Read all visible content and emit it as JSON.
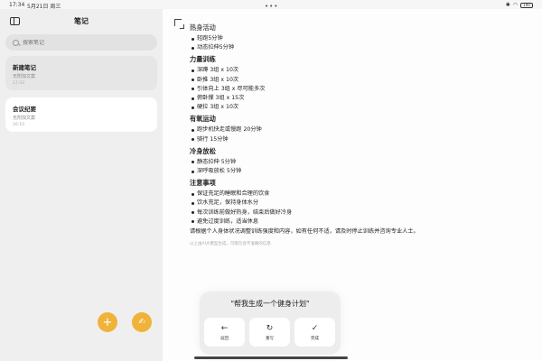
{
  "statusbar": {
    "time": "17:34",
    "date": "5月21日 周三",
    "more": "•••",
    "battery": "100"
  },
  "sidebar": {
    "title": "笔记",
    "search_placeholder": "搜索笔记",
    "notes": [
      {
        "title": "新建笔记",
        "subtitle": "无附加文案",
        "time": "17:33"
      },
      {
        "title": "会议纪要",
        "subtitle": "无附加文案",
        "time": "16:10"
      }
    ],
    "fab_add": "+",
    "fab_ai": "✍"
  },
  "document": {
    "top_heading": "热身活动",
    "sections": [
      {
        "heading": "",
        "items": [
          "轻跑5分钟",
          "动态拉伸5分钟"
        ]
      },
      {
        "heading": "力量训练",
        "items": [
          "深蹲 3组 x 10次",
          "卧推 3组 x 10次",
          "引体向上 3组 x 尽可能多次",
          "俯卧撑 3组 x 15次",
          "硬拉 3组 x 10次"
        ]
      },
      {
        "heading": "有氧运动",
        "items": [
          "跑步机快走或慢跑 20分钟",
          "骑行 15分钟"
        ]
      },
      {
        "heading": "冷身放松",
        "items": [
          "静态拉伸 5分钟",
          "深呼吸放松 5分钟"
        ]
      },
      {
        "heading": "注意事项",
        "items": [
          "保证充足的睡眠和合理的饮食",
          "饮水充足，保持身体水分",
          "每次训练前做好热身，结束后做好冷身",
          "避免过度训练，适当休息"
        ]
      }
    ],
    "closing": "请根据个人身体状况调整训练强度和内容，如有任何不适，请及时停止训练并咨询专业人士。",
    "disclaimer": "以上由AI大模型生成，可能包含不准确的信息"
  },
  "ai_panel": {
    "prompt": "\"帮我生成一个健身计划\"",
    "buttons": [
      {
        "icon": "←",
        "label": "返回"
      },
      {
        "icon": "↻",
        "label": "重写"
      },
      {
        "icon": "✓",
        "label": "完成"
      }
    ]
  }
}
